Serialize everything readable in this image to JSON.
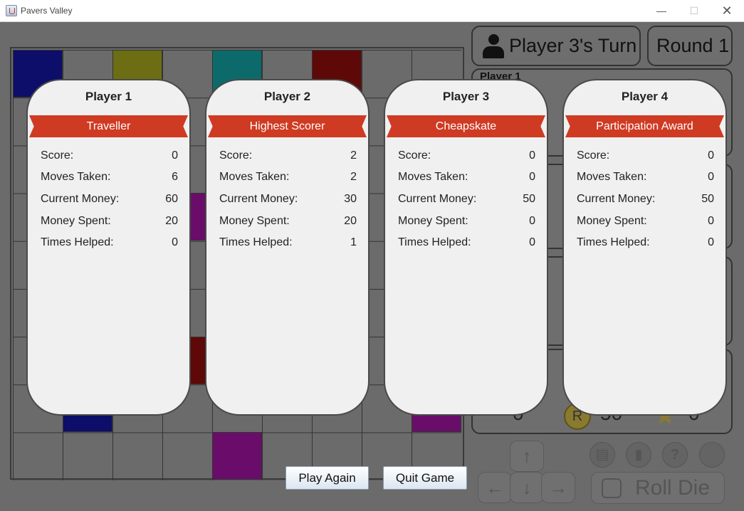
{
  "window": {
    "title": "Pavers Valley"
  },
  "colors": {
    "overlay_bg": "#6b6b6b",
    "card_bg": "#f0f0f0",
    "ribbon": "#cf3a23",
    "tile_blue": "#0d0d6a",
    "tile_olive": "#6d6d14",
    "tile_teal": "#0d6a6a",
    "tile_maroon": "#5e0808",
    "tile_purple": "#6a0d6a"
  },
  "header": {
    "turn_label": "Player 3's Turn",
    "round_label": "Round 1"
  },
  "side_panel": {
    "player_label": "Player 1",
    "stats": {
      "moves": "0",
      "money": "50",
      "score": "0"
    }
  },
  "cards": [
    {
      "title": "Player 1",
      "award": "Traveller",
      "stats": [
        {
          "label": "Score:",
          "value": "0"
        },
        {
          "label": "Moves Taken:",
          "value": "6"
        },
        {
          "label": "Current Money:",
          "value": "60"
        },
        {
          "label": "Money Spent:",
          "value": "20"
        },
        {
          "label": "Times Helped:",
          "value": "0"
        }
      ]
    },
    {
      "title": "Player 2",
      "award": "Highest Scorer",
      "stats": [
        {
          "label": "Score:",
          "value": "2"
        },
        {
          "label": "Moves Taken:",
          "value": "2"
        },
        {
          "label": "Current Money:",
          "value": "30"
        },
        {
          "label": "Money Spent:",
          "value": "20"
        },
        {
          "label": "Times Helped:",
          "value": "1"
        }
      ]
    },
    {
      "title": "Player 3",
      "award": "Cheapskate",
      "stats": [
        {
          "label": "Score:",
          "value": "0"
        },
        {
          "label": "Moves Taken:",
          "value": "0"
        },
        {
          "label": "Current Money:",
          "value": "50"
        },
        {
          "label": "Money Spent:",
          "value": "0"
        },
        {
          "label": "Times Helped:",
          "value": "0"
        }
      ]
    },
    {
      "title": "Player 4",
      "award": "Participation Award",
      "stats": [
        {
          "label": "Score:",
          "value": "0"
        },
        {
          "label": "Moves Taken:",
          "value": "0"
        },
        {
          "label": "Current Money:",
          "value": "50"
        },
        {
          "label": "Money Spent:",
          "value": "0"
        },
        {
          "label": "Times Helped:",
          "value": "0"
        }
      ]
    }
  ],
  "buttons": {
    "play_again": "Play Again",
    "quit_game": "Quit Game"
  },
  "controls": {
    "roll_die": "Roll Die",
    "coin_letter": "R",
    "icons": [
      "save-icon",
      "book-icon",
      "help-icon",
      "settings-icon"
    ],
    "arrows": [
      "arrow-up-icon",
      "arrow-left-icon",
      "arrow-down-icon",
      "arrow-right-icon"
    ]
  }
}
